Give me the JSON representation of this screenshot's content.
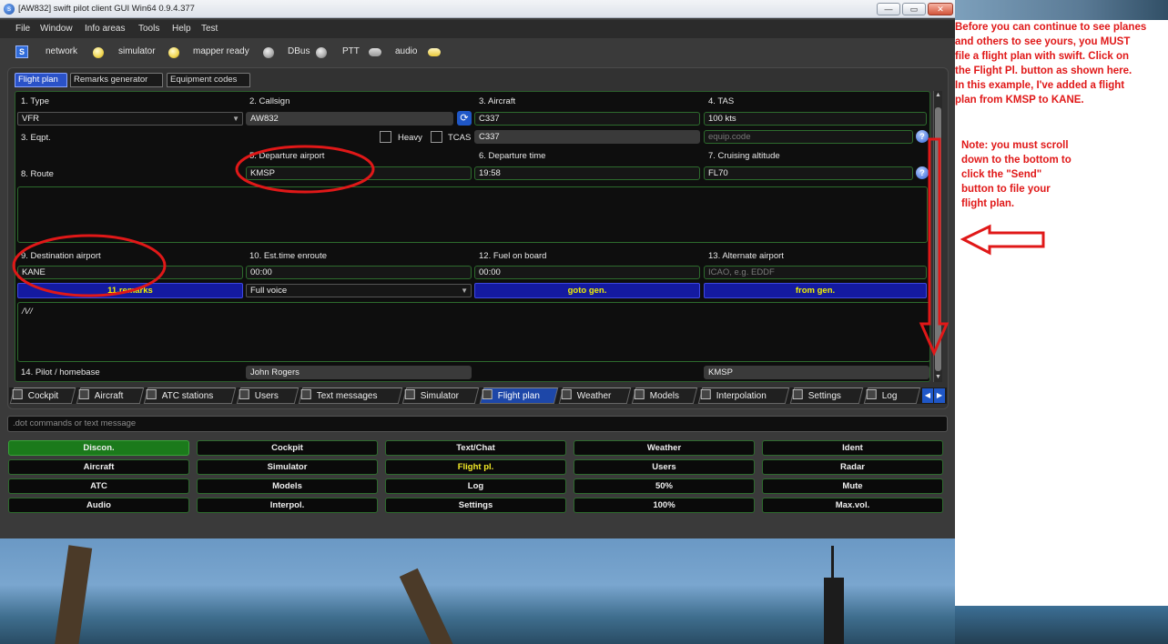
{
  "window": {
    "title": "[AW832] swift pilot client GUI Win64 0.9.4.377",
    "controls": {
      "minimize": "—",
      "restore": "▭",
      "close": "✕"
    }
  },
  "menu": [
    "File",
    "Window",
    "Info areas",
    "Tools",
    "Help",
    "Test"
  ],
  "status": {
    "swift_icon": "S",
    "items": [
      {
        "label": "network",
        "state": "on"
      },
      {
        "label": "simulator",
        "state": "on"
      },
      {
        "label": "mapper ready",
        "state": "off"
      },
      {
        "label": "DBus",
        "state": "off"
      },
      {
        "label": "PTT",
        "state": "off"
      },
      {
        "label": "audio",
        "state": "on"
      }
    ]
  },
  "top_tabs": [
    "Flight plan",
    "Remarks generator",
    "Equipment codes"
  ],
  "form": {
    "type_label": "1. Type",
    "type_value": "VFR",
    "callsign_label": "2. Callsign",
    "callsign_value": "AW832",
    "aircraft_label": "3. Aircraft",
    "aircraft_value": "C337",
    "tas_label": "4. TAS",
    "tas_value": "100 kts",
    "eqpt_label": "3. Eqpt.",
    "heavy_label": "Heavy",
    "tcas_label": "TCAS",
    "eqpt_aircraft_value": "C337",
    "equip_code_placeholder": "equip.code",
    "departure_label": "5. Departure airport",
    "departure_value": "KMSP",
    "departure_time_label": "6. Departure time",
    "departure_time_value": "19:58",
    "cruising_label": "7. Cruising altitude",
    "cruising_value": "FL70",
    "route_label": "8. Route",
    "route_value": "",
    "destination_label": "9. Destination airport",
    "destination_value": "KANE",
    "est_time_label": "10. Est.time enroute",
    "est_time_value": "00:00",
    "fuel_label": "12. Fuel on board",
    "fuel_value": "00:00",
    "alternate_label": "13. Alternate airport",
    "alternate_placeholder": "ICAO, e.g. EDDF",
    "remarks_button": "11.remarks",
    "voice_value": "Full voice",
    "goto_gen_button": "goto gen.",
    "from_gen_button": "from gen.",
    "remarks_text": "/V/",
    "pilot_label": "14. Pilot / homebase",
    "pilot_value": "John Rogers",
    "homebase_value": "KMSP",
    "help_icon": "?",
    "reload_icon": "⟳"
  },
  "bottom_tabs": [
    "Cockpit",
    "Aircraft",
    "ATC stations",
    "Users",
    "Text messages",
    "Simulator",
    "Flight plan",
    "Weather",
    "Models",
    "Interpolation",
    "Settings",
    "Log"
  ],
  "command_placeholder": ".dot commands or text message",
  "buttons": [
    [
      "Discon.",
      "Cockpit",
      "Text/Chat",
      "Weather",
      "Ident"
    ],
    [
      "Aircraft",
      "Simulator",
      "Flight pl.",
      "Users",
      "Radar"
    ],
    [
      "ATC",
      "Models",
      "Log",
      "50%",
      "Mute"
    ],
    [
      "Audio",
      "Interpol.",
      "Settings",
      "100%",
      "Max.vol."
    ]
  ],
  "annotations": {
    "main": [
      "Before you can continue to see planes",
      "and others to see yours, you MUST",
      "file a flight plan with swift.  Click on",
      "the Flight Pl. button as shown here.",
      "In this example, I've added a flight",
      "plan from KMSP to KANE."
    ],
    "note": [
      "Note:  you must scroll",
      "down to the bottom to",
      "click the \"Send\"",
      "button to file your",
      "flight plan."
    ]
  },
  "colors": {
    "accent_blue": "#1d47a8",
    "annotation_red": "#e01818",
    "field_border": "#2d6b2d",
    "button_yellow": "#f3ea28",
    "disconnect_green": "#1b7a1b"
  }
}
